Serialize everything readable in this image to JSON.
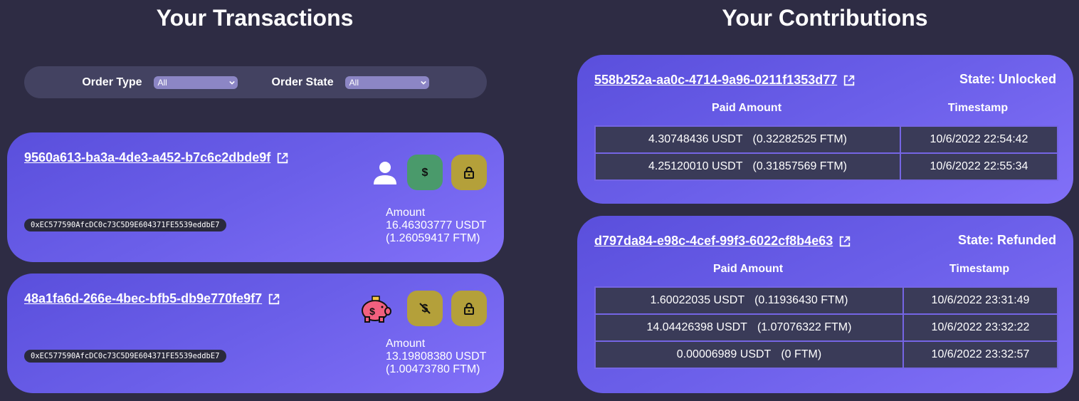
{
  "transactions": {
    "title": "Your Transactions",
    "filters": {
      "order_type_label": "Order Type",
      "order_type_value": "All",
      "order_state_label": "Order State",
      "order_state_value": "All"
    },
    "items": [
      {
        "id": "9560a613-ba3a-4de3-a452-b7c6c2dbde9f",
        "address": "0xEC577590AfcDC0c73C5D9E604371FE5539eddbE7",
        "amount_label": "Amount",
        "amount_usdt": "16.46303777 USDT",
        "amount_ftm": "(1.26059417 FTM)",
        "icons": [
          "user-icon",
          "dollar-icon",
          "lock-icon"
        ]
      },
      {
        "id": "48a1fa6d-266e-4bec-bfb5-db9e770fe9f7",
        "address": "0xEC577590AfcDC0c73C5D9E604371FE5539eddbE7",
        "amount_label": "Amount",
        "amount_usdt": "13.19808380 USDT",
        "amount_ftm": "(1.00473780 FTM)",
        "icons": [
          "piggy-bank-icon",
          "dollar-off-icon",
          "lock-icon"
        ]
      }
    ]
  },
  "contributions": {
    "title": "Your Contributions",
    "items": [
      {
        "id": "558b252a-aa0c-4714-9a96-0211f1353d77",
        "state": "State: Unlocked",
        "col_paid": "Paid Amount",
        "col_time": "Timestamp",
        "rows": [
          {
            "usdt": "4.30748436 USDT",
            "ftm": "(0.32282525 FTM)",
            "time": "10/6/2022 22:54:42"
          },
          {
            "usdt": "4.25120010 USDT",
            "ftm": "(0.31857569 FTM)",
            "time": "10/6/2022 22:55:34"
          }
        ]
      },
      {
        "id": "d797da84-e98c-4cef-99f3-6022cf8b4e63",
        "state": "State: Refunded",
        "col_paid": "Paid Amount",
        "col_time": "Timestamp",
        "rows": [
          {
            "usdt": "1.60022035 USDT",
            "ftm": "(0.11936430 FTM)",
            "time": "10/6/2022 23:31:49"
          },
          {
            "usdt": "14.04426398 USDT",
            "ftm": "(1.07076322 FTM)",
            "time": "10/6/2022 23:32:22"
          },
          {
            "usdt": "0.00006989 USDT",
            "ftm": "(0 FTM)",
            "time": "10/6/2022 23:32:57"
          }
        ]
      }
    ]
  },
  "colors": {
    "background": "#2e2c44",
    "card_gradient_start": "#5a4fdc",
    "card_gradient_end": "#8270f8",
    "green_button": "#4a9a6b",
    "gold_button": "#b4a03a",
    "table_cell": "#3a3b58"
  }
}
